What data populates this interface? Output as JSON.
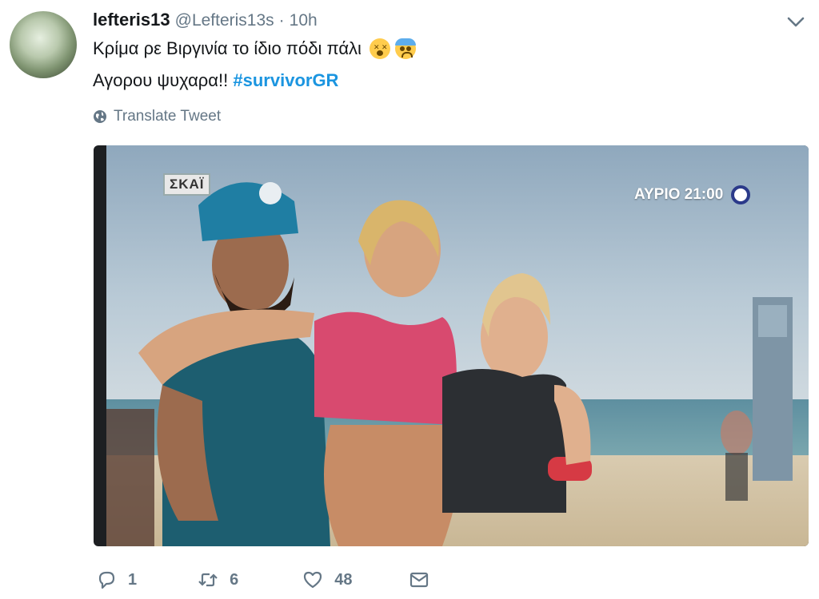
{
  "tweet": {
    "name": "lefteris13",
    "handle": "@Lefteris13s",
    "separator": "·",
    "time": "10h",
    "line1": "Κρίμα ρε Βιργινία το ίδιο πόδι πάλι",
    "line2": "Αγορου ψυχαρα!!",
    "hashtag": "#survivorGR",
    "translate_label": "Translate Tweet"
  },
  "video": {
    "channel_logo": "ΣΚΑΪ",
    "promo_text": "ΑΥΡΙΟ 21:00"
  },
  "actions": {
    "reply_count": "1",
    "retweet_count": "6",
    "like_count": "48"
  },
  "icons": {
    "caret": "chevron-down-icon",
    "globe": "globe-icon",
    "reply": "reply-icon",
    "retweet": "retweet-icon",
    "like": "heart-icon",
    "dm": "envelope-icon"
  },
  "colors": {
    "hashtag": "#1b95e0",
    "muted": "#657786"
  }
}
